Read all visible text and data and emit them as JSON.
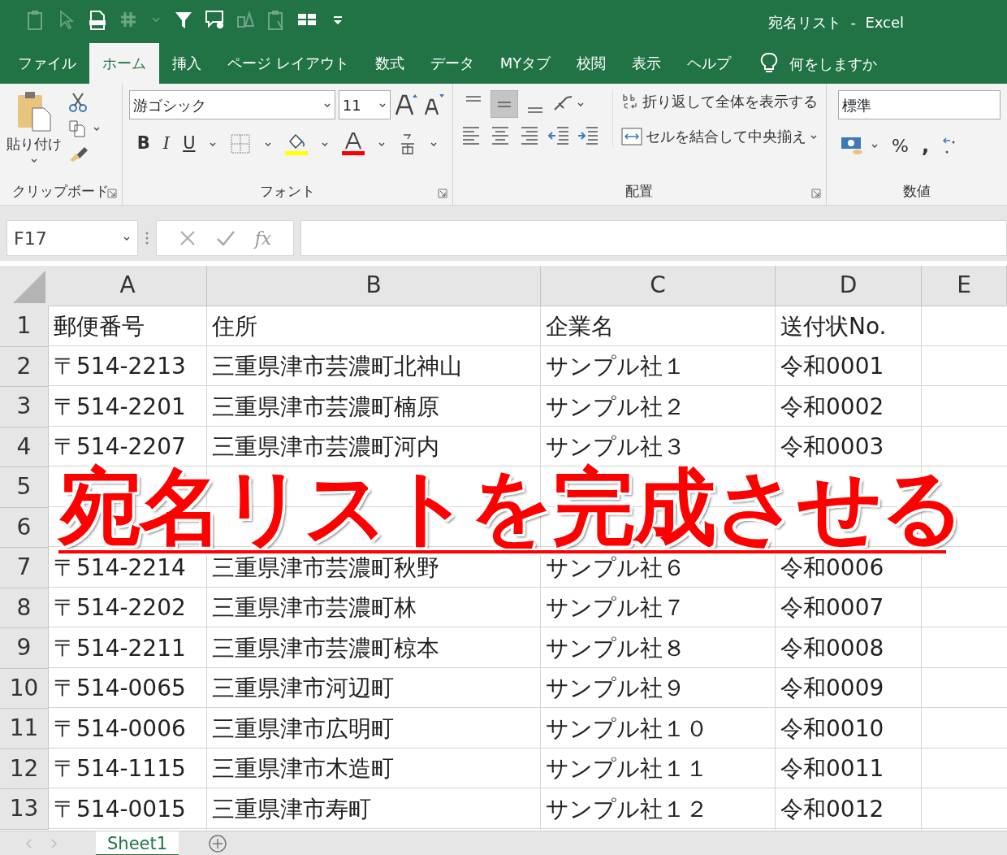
{
  "window": {
    "title": "宛名リスト  -  Excel"
  },
  "quick_access": [
    {
      "kind": "clip123",
      "disabled": true
    },
    {
      "kind": "pointer",
      "disabled": true
    },
    {
      "kind": "page",
      "disabled": false
    },
    {
      "kind": "cross",
      "disabled": true
    },
    {
      "kind": "caret",
      "disabled": true
    },
    {
      "kind": "filter",
      "disabled": false
    },
    {
      "kind": "comment",
      "disabled": false
    },
    {
      "kind": "shapes",
      "disabled": true
    },
    {
      "kind": "clipfx",
      "disabled": true
    },
    {
      "kind": "grid",
      "disabled": false
    },
    {
      "kind": "more",
      "disabled": false
    }
  ],
  "tabs": [
    {
      "label": "ファイル",
      "selected": false
    },
    {
      "label": "ホーム",
      "selected": true
    },
    {
      "label": "挿入",
      "selected": false
    },
    {
      "label": "ページ レイアウト",
      "selected": false
    },
    {
      "label": "数式",
      "selected": false
    },
    {
      "label": "データ",
      "selected": false
    },
    {
      "label": "MYタブ",
      "selected": false
    },
    {
      "label": "校閲",
      "selected": false
    },
    {
      "label": "表示",
      "selected": false
    },
    {
      "label": "ヘルプ",
      "selected": false
    }
  ],
  "tell_me": {
    "placeholder": "何をしますか"
  },
  "ribbon": {
    "clipboard": {
      "paste": "貼り付け",
      "label": "クリップボード"
    },
    "font": {
      "name": "游ゴシック",
      "size": "11",
      "bold": "B",
      "italic": "I",
      "underline": "U",
      "label": "フォント"
    },
    "alignment": {
      "vertical": [
        {
          "selected": false
        },
        {
          "selected": true
        },
        {
          "selected": false
        }
      ],
      "wrap": "折り返して全体を表示する",
      "merge": "セルを結合して中央揃え",
      "label": "配置"
    },
    "number": {
      "format": "標準",
      "percent": "%",
      "comma": ",",
      "label": "数値"
    }
  },
  "formula_bar": {
    "name_box": "F17",
    "fx": "fx"
  },
  "sheet": {
    "columns": [
      "A",
      "B",
      "C",
      "D",
      "E"
    ],
    "rows": [
      {
        "number": "1",
        "cells": [
          "郵便番号",
          "住所",
          "企業名",
          "送付状No."
        ]
      },
      {
        "number": "2",
        "cells": [
          "〒514-2213",
          "三重県津市芸濃町北神山",
          "サンプル社１",
          "令和0001"
        ]
      },
      {
        "number": "3",
        "cells": [
          "〒514-2201",
          "三重県津市芸濃町楠原",
          "サンプル社２",
          "令和0002"
        ]
      },
      {
        "number": "4",
        "cells": [
          "〒514-2207",
          "三重県津市芸濃町河内",
          "サンプル社３",
          "令和0003"
        ]
      },
      {
        "number": "5",
        "cells": [
          null,
          null,
          null,
          null
        ]
      },
      {
        "number": "6",
        "cells": [
          null,
          null,
          null,
          null
        ]
      },
      {
        "number": "7",
        "cells": [
          "〒514-2214",
          "三重県津市芸濃町秋野",
          "サンプル社６",
          "令和0006"
        ]
      },
      {
        "number": "8",
        "cells": [
          "〒514-2202",
          "三重県津市芸濃町林",
          "サンプル社７",
          "令和0007"
        ]
      },
      {
        "number": "9",
        "cells": [
          "〒514-2211",
          "三重県津市芸濃町椋本",
          "サンプル社８",
          "令和0008"
        ]
      },
      {
        "number": "10",
        "cells": [
          "〒514-0065",
          "三重県津市河辺町",
          "サンプル社９",
          "令和0009"
        ]
      },
      {
        "number": "11",
        "cells": [
          "〒514-0006",
          "三重県津市広明町",
          "サンプル社１０",
          "令和0010"
        ]
      },
      {
        "number": "12",
        "cells": [
          "〒514-1115",
          "三重県津市木造町",
          "サンプル社１１",
          "令和0011"
        ]
      },
      {
        "number": "13",
        "cells": [
          "〒514-0015",
          "三重県津市寿町",
          "サンプル社１２",
          "令和0012"
        ]
      }
    ]
  },
  "overlay_caption": "宛名リストを完成させる",
  "sheet_tabs": [
    {
      "label": "Sheet1",
      "selected": true
    }
  ]
}
